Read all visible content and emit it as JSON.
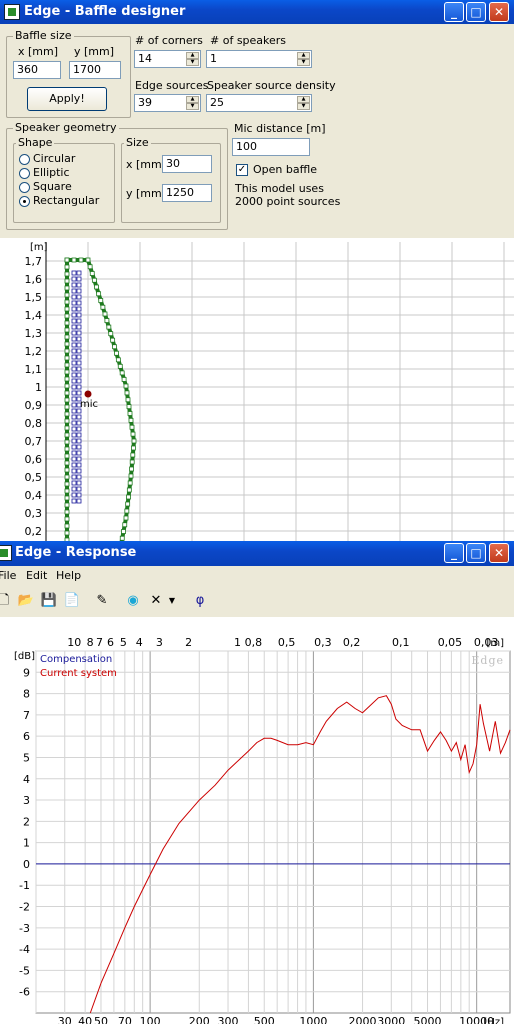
{
  "baffle_window": {
    "title": "Edge - Baffle designer",
    "baffle_size": {
      "legend": "Baffle size",
      "x_label": "x [mm]",
      "y_label": "y [mm]",
      "x_value": "360",
      "y_value": "1700",
      "apply_label": "Apply!"
    },
    "corners": {
      "label": "# of corners",
      "value": "14"
    },
    "speakers": {
      "label": "# of speakers",
      "value": "1"
    },
    "edge_sources": {
      "label": "Edge sources",
      "value": "39"
    },
    "source_density": {
      "label": "Speaker source density",
      "value": "25"
    },
    "geometry": {
      "legend": "Speaker geometry",
      "shape_legend": "Shape",
      "shapes": [
        "Circular",
        "Elliptic",
        "Square",
        "Rectangular"
      ],
      "selected": "Rectangular",
      "size_legend": "Size",
      "x_label": "x [mm]",
      "y_label": "y [mm]",
      "x_value": "30",
      "y_value": "1250"
    },
    "mic": {
      "label": "Mic distance [m]",
      "value": "100"
    },
    "open_baffle": {
      "label": "Open baffle",
      "checked": true
    },
    "info_line1": "This model uses",
    "info_line2": "2000 point sources",
    "plot": {
      "unit": "[m]",
      "y_ticks": [
        "1,7",
        "1,6",
        "1,5",
        "1,4",
        "1,3",
        "1,2",
        "1,1",
        "1",
        "0,9",
        "0,8",
        "0,7",
        "0,6",
        "0,5",
        "0,4",
        "0,3",
        "0,2"
      ],
      "mic_label": "mic",
      "edge_color": "#1f7a1f",
      "driver_color": "#1a1a9a"
    }
  },
  "response_window": {
    "title": "Edge - Response",
    "menu": [
      "File",
      "Edit",
      "Help"
    ],
    "toolbar_icons": [
      "new-icon",
      "open-icon",
      "save-icon",
      "copy-icon",
      "pen-icon",
      "speaker-icon",
      "delete-icon",
      "dropdown-icon",
      "phi-icon"
    ],
    "phi_glyph": "φ"
  },
  "chart_data": {
    "type": "line",
    "title": "",
    "ylabel": "[dB]",
    "xlabel": "[Hz]",
    "x_scale": "log",
    "xlim": [
      20,
      16000
    ],
    "ylim": [
      -7,
      10
    ],
    "watermark": "Edge",
    "x_tick_labels": [
      "30",
      "40",
      "50",
      "70",
      "100",
      "200",
      "300",
      "500",
      "1000",
      "2000",
      "3000",
      "5000",
      "10000"
    ],
    "x_ticks": [
      30,
      40,
      50,
      70,
      100,
      200,
      300,
      500,
      1000,
      2000,
      3000,
      5000,
      10000
    ],
    "y_ticks": [
      10,
      9,
      8,
      7,
      6,
      5,
      4,
      3,
      2,
      1,
      0,
      -1,
      -2,
      -3,
      -4,
      -5,
      -6
    ],
    "y_tick_labels": [
      "",
      "9",
      "8",
      "7",
      "6",
      "5",
      "4",
      "3",
      "2",
      "1",
      "0",
      "-1",
      "-2",
      "-3",
      "-4",
      "-5",
      "-6"
    ],
    "top_axis_unit": "[m]",
    "top_axis_labels": [
      {
        "label": "10",
        "hz": 34.3
      },
      {
        "label": "8",
        "hz": 42.9
      },
      {
        "label": "7",
        "hz": 49
      },
      {
        "label": "6",
        "hz": 57.2
      },
      {
        "label": "5",
        "hz": 68.6
      },
      {
        "label": "4",
        "hz": 85.8
      },
      {
        "label": "3",
        "hz": 114
      },
      {
        "label": "2",
        "hz": 172
      },
      {
        "label": "1",
        "hz": 343
      },
      {
        "label": "0,8",
        "hz": 429
      },
      {
        "label": "0,5",
        "hz": 686
      },
      {
        "label": "0,3",
        "hz": 1143
      },
      {
        "label": "0,2",
        "hz": 1715
      },
      {
        "label": "0,1",
        "hz": 3430
      },
      {
        "label": "0,05",
        "hz": 6860
      },
      {
        "label": "0,03",
        "hz": 11433
      }
    ],
    "legend": [
      "Compensation",
      "Current system"
    ],
    "series": [
      {
        "name": "Compensation",
        "color": "#1a1a9a",
        "x": [
          20,
          16000
        ],
        "y": [
          0,
          0
        ]
      },
      {
        "name": "Current system",
        "color": "#cc0000",
        "x": [
          43,
          50,
          60,
          70,
          80,
          90,
          100,
          120,
          150,
          200,
          250,
          300,
          400,
          450,
          500,
          550,
          600,
          700,
          800,
          900,
          1000,
          1100,
          1200,
          1400,
          1600,
          1800,
          2000,
          2200,
          2500,
          2800,
          3000,
          3200,
          3500,
          4000,
          4500,
          5000,
          5500,
          6000,
          6500,
          7000,
          7500,
          8000,
          8500,
          9000,
          9500,
          10000,
          10500,
          11000,
          12000,
          13000,
          14000,
          15000,
          16000
        ],
        "y": [
          -7,
          -5.6,
          -4.2,
          -3.0,
          -2.0,
          -1.2,
          -0.5,
          0.7,
          1.9,
          3.0,
          3.7,
          4.4,
          5.3,
          5.7,
          5.9,
          5.9,
          5.8,
          5.6,
          5.6,
          5.7,
          5.6,
          6.2,
          6.7,
          7.3,
          7.6,
          7.3,
          7.1,
          7.4,
          7.8,
          7.9,
          7.5,
          6.8,
          6.5,
          6.3,
          6.3,
          5.3,
          5.8,
          6.2,
          5.8,
          5.3,
          5.7,
          4.9,
          5.6,
          4.3,
          4.7,
          5.6,
          7.5,
          6.6,
          5.3,
          6.7,
          5.2,
          5.7,
          6.3
        ]
      }
    ]
  }
}
